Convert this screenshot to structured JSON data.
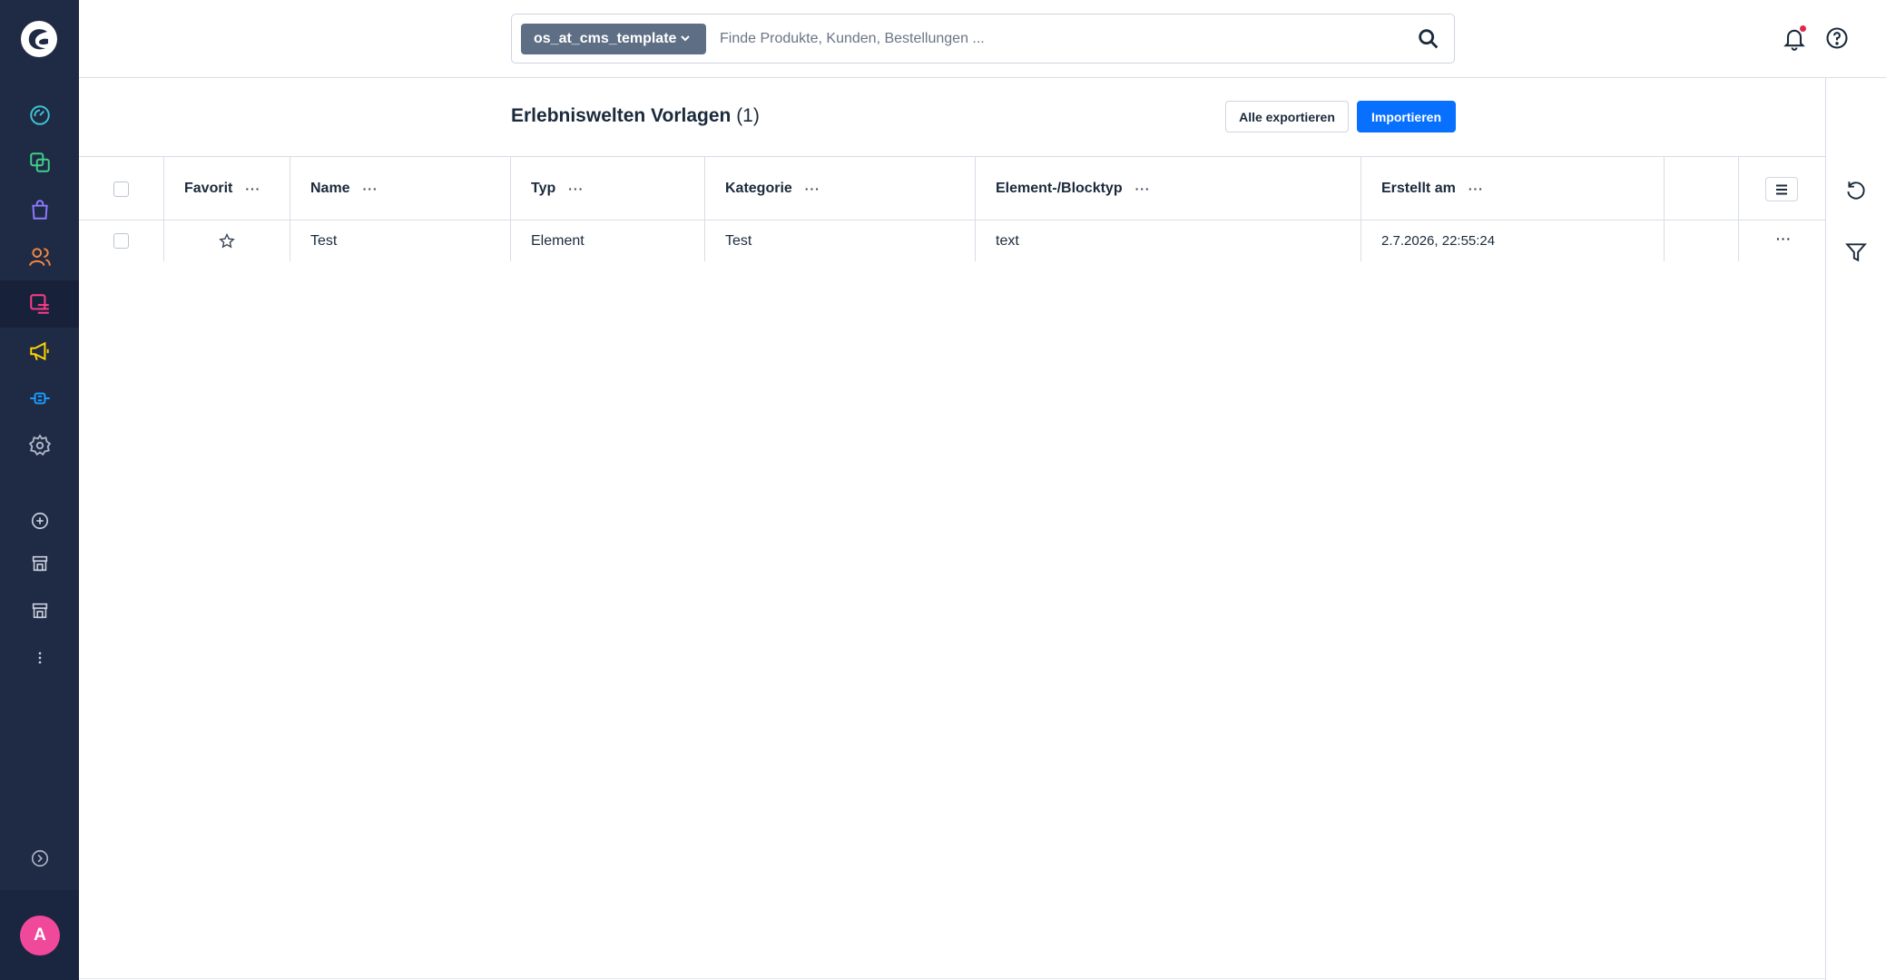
{
  "search": {
    "type_label": "os_at_cms_template",
    "placeholder": "Finde Produkte, Kunden, Bestellungen ..."
  },
  "page": {
    "title": "Erlebniswelten Vorlagen",
    "count": "(1)"
  },
  "actions": {
    "export_all": "Alle exportieren",
    "import": "Importieren"
  },
  "grid": {
    "columns": [
      {
        "label": "Favorit"
      },
      {
        "label": "Name"
      },
      {
        "label": "Typ"
      },
      {
        "label": "Kategorie"
      },
      {
        "label": "Element-/Blocktyp"
      },
      {
        "label": "Erstellt am"
      }
    ],
    "column_dots": "···",
    "rows": [
      {
        "name": "Test",
        "typ": "Element",
        "kategorie": "Test",
        "blocktyp": "text",
        "erstellt_am": "2.7.2026, 22:55:24",
        "actions": "···"
      }
    ]
  },
  "user": {
    "avatar_initial": "A"
  },
  "colors": {
    "sidebar_bg": "#1f2a44",
    "primary": "#0870ff",
    "avatar": "#f0489b",
    "notification_dot": "#de294c"
  },
  "icons": {
    "sidebar": [
      "dashboard-icon",
      "catalogue-icon",
      "orders-icon",
      "customers-icon",
      "content-icon",
      "marketing-icon",
      "extensions-icon",
      "settings-icon",
      "add-sales-channel-icon",
      "storefront-icon",
      "storefront-icon",
      "more-icon",
      "collapse-icon"
    ],
    "right_bar": [
      "refresh-icon",
      "filter-icon"
    ]
  }
}
